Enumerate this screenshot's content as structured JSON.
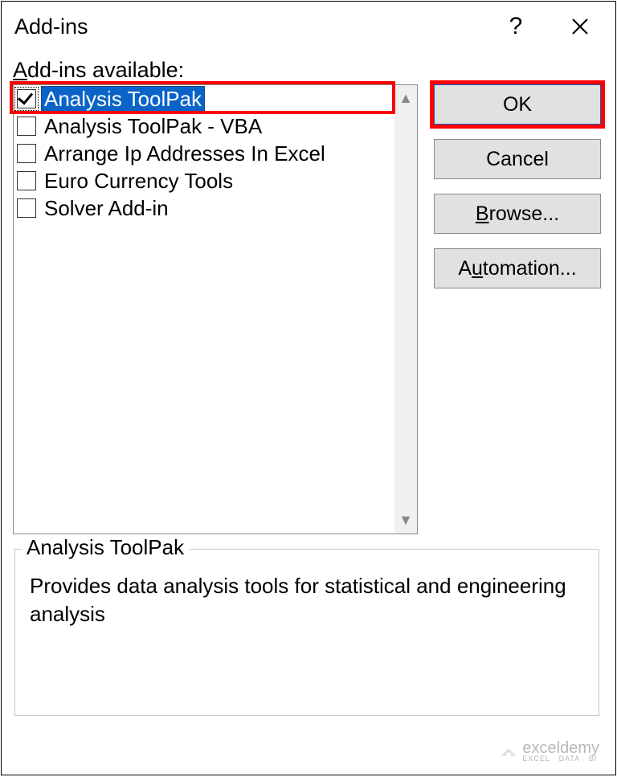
{
  "titlebar": {
    "title": "Add-ins"
  },
  "label_available_prefix": "A",
  "label_available_rest": "dd-ins available:",
  "addins": {
    "items": [
      {
        "label": "Analysis ToolPak",
        "checked": true,
        "selected": true
      },
      {
        "label": "Analysis ToolPak - VBA",
        "checked": false,
        "selected": false
      },
      {
        "label": "Arrange Ip Addresses In Excel",
        "checked": false,
        "selected": false
      },
      {
        "label": "Euro Currency Tools",
        "checked": false,
        "selected": false
      },
      {
        "label": "Solver Add-in",
        "checked": false,
        "selected": false
      }
    ]
  },
  "buttons": {
    "ok": "OK",
    "cancel": "Cancel",
    "browse_ul": "B",
    "browse_rest": "rowse...",
    "automation_pre": "A",
    "automation_ul": "u",
    "automation_rest": "tomation..."
  },
  "details": {
    "title": "Analysis ToolPak",
    "description": "Provides data analysis tools for statistical and engineering analysis"
  },
  "watermark": {
    "brand": "exceldemy",
    "sub": "EXCEL · DATA · BI"
  }
}
